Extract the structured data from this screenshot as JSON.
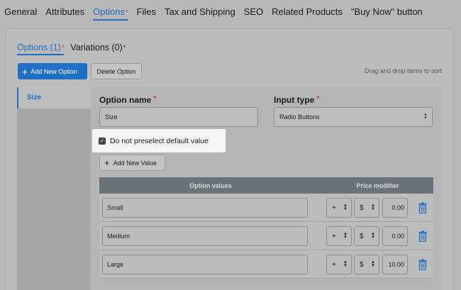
{
  "top_tabs": [
    {
      "label": "General"
    },
    {
      "label": "Attributes"
    },
    {
      "label": "Options",
      "active": true,
      "required_mark": "*"
    },
    {
      "label": "Files"
    },
    {
      "label": "Tax and Shipping"
    },
    {
      "label": "SEO"
    },
    {
      "label": "Related Products"
    },
    {
      "label": "\"Buy Now\" button"
    }
  ],
  "sub_tabs": [
    {
      "label": "Options (1)",
      "mark": "*"
    },
    {
      "label": "Variations (0)",
      "mark": "*"
    }
  ],
  "toolbar": {
    "add_option_label": "Add New Option",
    "delete_option_label": "Delete Option",
    "drag_hint": "Drag and drop items to sort"
  },
  "sidebar": {
    "items": [
      {
        "label": "Size"
      }
    ]
  },
  "option": {
    "name_label": "Option name",
    "name_value": "Size",
    "input_type_label": "Input type",
    "input_type_value": "Radio Buttons",
    "required_mark": "*",
    "preselect_label": "Do not preselect default value",
    "add_value_label": "Add New Value"
  },
  "values_table": {
    "headers": {
      "values": "Option values",
      "price": "Price modifier"
    },
    "rows": [
      {
        "name": "Small",
        "sign": "+",
        "unit": "$",
        "price": "0.00"
      },
      {
        "name": "Medium",
        "sign": "+",
        "unit": "$",
        "price": "0.00"
      },
      {
        "name": "Large",
        "sign": "+",
        "unit": "$",
        "price": "10.00"
      }
    ]
  },
  "colors": {
    "accent": "#1f6fc5",
    "required": "#dd3333",
    "table_header": "#6c7378"
  }
}
